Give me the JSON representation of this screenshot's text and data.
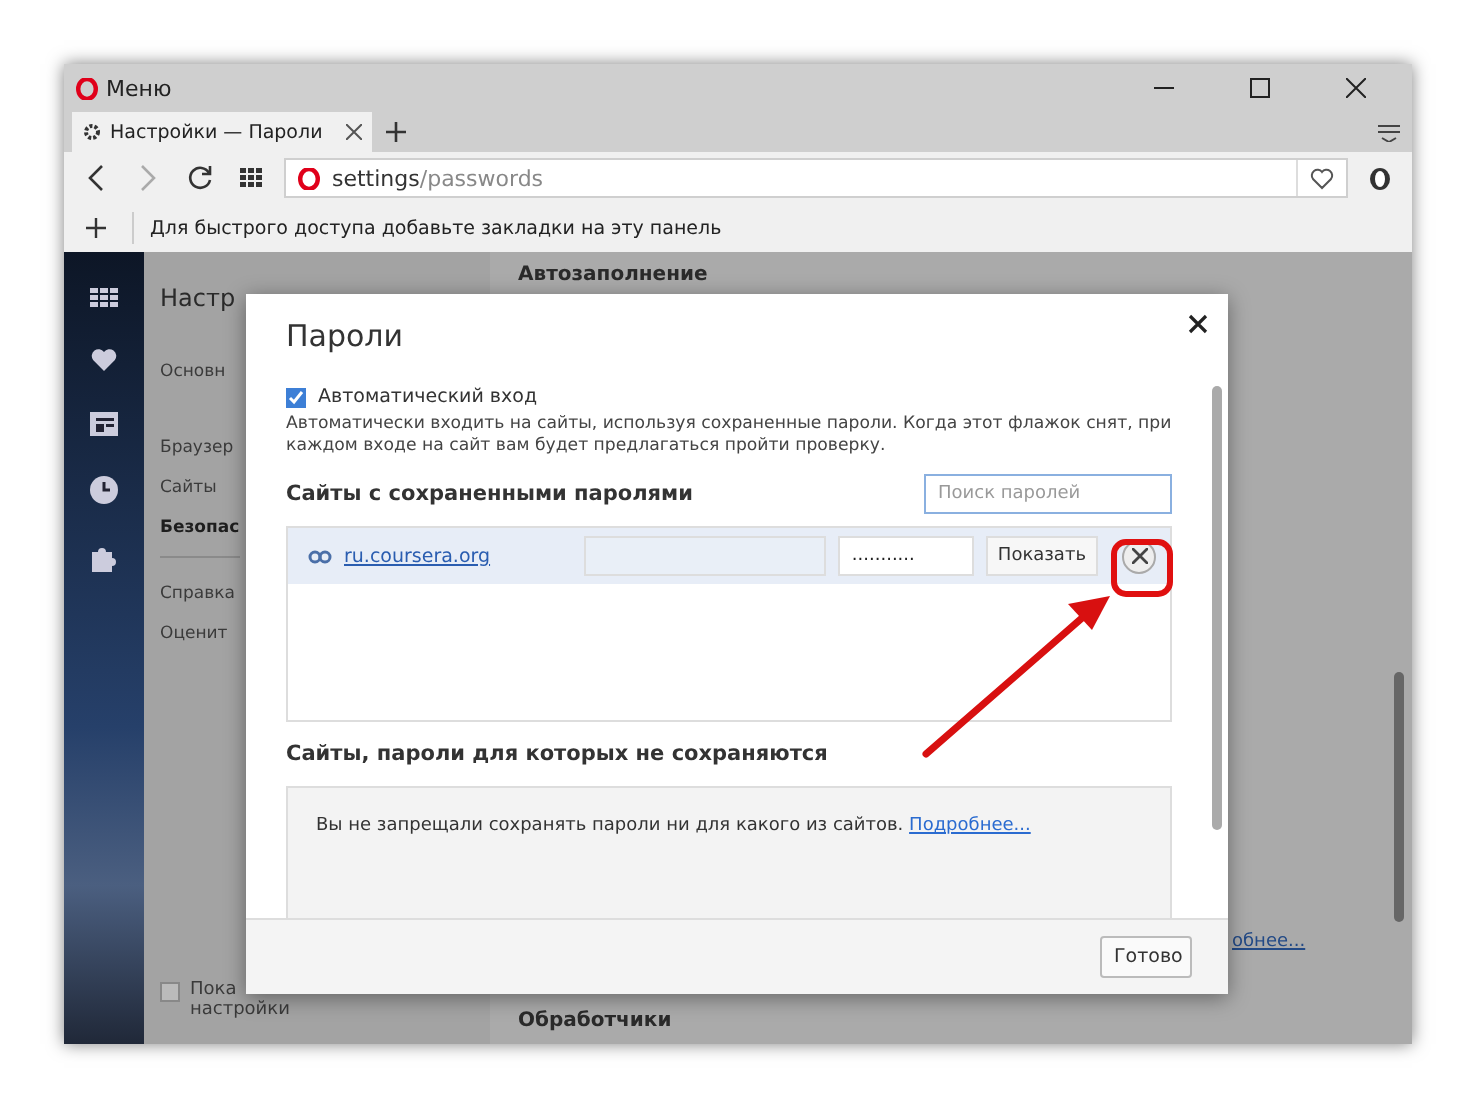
{
  "window": {
    "title": "Меню"
  },
  "tabs": [
    {
      "label": "Настройки — Пароли",
      "selected": true
    }
  ],
  "address_bar": {
    "host": "settings",
    "path": "/passwords"
  },
  "bookmarks_bar": {
    "hint": "Для быстрого доступа добавьте закладки на эту панель"
  },
  "settings_nav": {
    "title": "Настр",
    "items": [
      {
        "label": "Основн",
        "selected": false
      },
      {
        "label": "Браузер",
        "selected": false
      },
      {
        "label": "Сайты",
        "selected": false
      },
      {
        "label": "Безопас",
        "selected": true
      }
    ],
    "links": [
      "Справка",
      "Оценит"
    ],
    "advanced": {
      "label": "Пока",
      "label_line2": "настройки",
      "checked": false
    }
  },
  "main": {
    "sections": [
      "Автозаполнение",
      "Обработчики"
    ],
    "link": "обнее..."
  },
  "dialog": {
    "title": "Пароли",
    "auto_login": {
      "label": "Автоматический вход",
      "checked": true,
      "description": "Автоматически входить на сайты, используя сохраненные пароли. Когда этот флажок снят, при каждом входе на сайт вам будет предлагаться пройти проверку."
    },
    "saved_heading": "Сайты с сохраненными паролями",
    "search": {
      "placeholder": "Поиск паролей"
    },
    "saved": [
      {
        "site": "ru.coursera.org",
        "password": "...........",
        "show_label": "Показать",
        "selected": true
      }
    ],
    "never_heading": "Сайты, пароли для которых не сохраняются",
    "never_text": "Вы не запрещали сохранять пароли ни для какого из сайтов.",
    "never_link": "Подробнее...",
    "done": "Готово"
  }
}
